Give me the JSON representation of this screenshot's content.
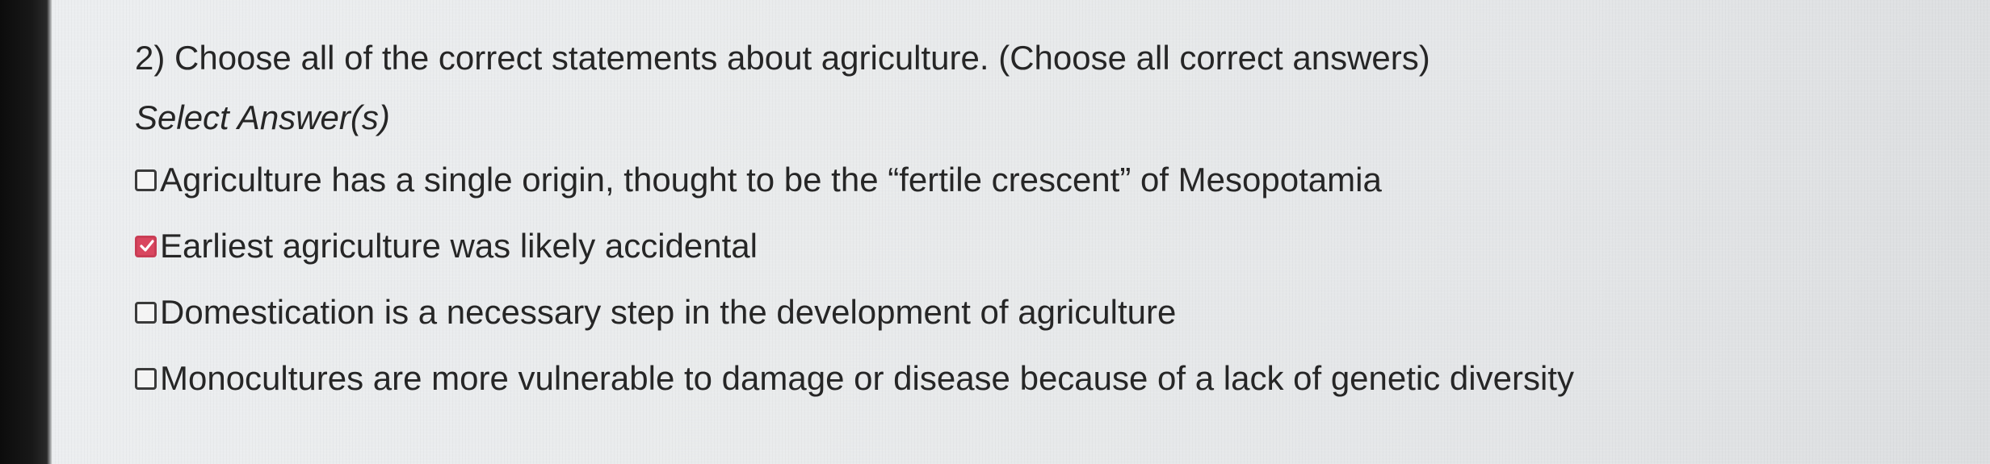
{
  "question": {
    "title": "2) Choose all of the correct statements about agriculture. (Choose all correct answers)",
    "instruction": "Select Answer(s)",
    "options": [
      {
        "label": "Agriculture has a single origin, thought to be the “fertile crescent” of Mesopotamia",
        "checked": false
      },
      {
        "label": "Earliest agriculture was likely accidental",
        "checked": true
      },
      {
        "label": "Domestication is a necessary step in the development of agriculture",
        "checked": false
      },
      {
        "label": "Monocultures are more vulnerable to damage or disease because of a lack of genetic diversity",
        "checked": false
      }
    ]
  },
  "colors": {
    "checked_box": "#d9465f",
    "text": "#262626",
    "background": "#e9ebec"
  }
}
